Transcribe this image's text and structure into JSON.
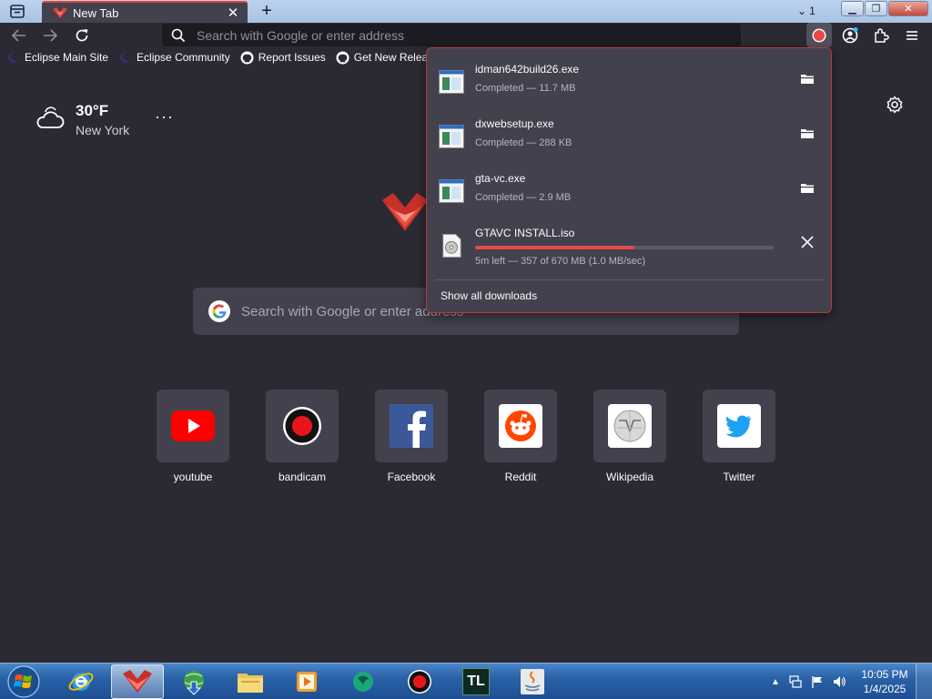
{
  "tabs": [
    {
      "title": "New Tab"
    }
  ],
  "tab_overflow_count": "1",
  "urlbar": {
    "placeholder": "Search with Google or enter address"
  },
  "bookmarks": [
    {
      "label": "Eclipse Main Site",
      "icon": "eclipse-icon"
    },
    {
      "label": "Eclipse Community",
      "icon": "eclipse-icon"
    },
    {
      "label": "Report Issues",
      "icon": "github-icon"
    },
    {
      "label": "Get New Releases",
      "icon": "github-icon"
    }
  ],
  "weather": {
    "temperature": "30°F",
    "city": "New York",
    "more": "···"
  },
  "search": {
    "placeholder": "Search with Google or enter address"
  },
  "shortcuts": [
    {
      "label": "youtube",
      "icon": "youtube-icon"
    },
    {
      "label": "bandicam",
      "icon": "bandicam-icon"
    },
    {
      "label": "Facebook",
      "icon": "facebook-icon"
    },
    {
      "label": "Reddit",
      "icon": "reddit-icon"
    },
    {
      "label": "Wikipedia",
      "icon": "wikipedia-icon"
    },
    {
      "label": "Twitter",
      "icon": "twitter-icon"
    }
  ],
  "downloads": {
    "items": [
      {
        "name": "idman642build26.exe",
        "status": "Completed — 11.7 MB"
      },
      {
        "name": "dxwebsetup.exe",
        "status": "Completed — 288 KB"
      },
      {
        "name": "gta-vc.exe",
        "status": "Completed — 2.9 MB"
      },
      {
        "name": "GTAVC INSTALL.iso",
        "status": "5m left — 357 of 670 MB (1.0 MB/sec)",
        "progress": 0.533
      }
    ],
    "show_all": "Show all downloads"
  },
  "taskbar": {
    "apps": [
      {
        "name": "internet-explorer"
      },
      {
        "name": "browser-active"
      },
      {
        "name": "internet-download-manager"
      },
      {
        "name": "file-explorer"
      },
      {
        "name": "media-player"
      },
      {
        "name": "green-app"
      },
      {
        "name": "bandicam"
      },
      {
        "name": "tl-launcher",
        "text": "TL"
      },
      {
        "name": "java"
      }
    ],
    "clock": {
      "time": "10:05 PM",
      "date": "1/4/2025"
    }
  },
  "colors": {
    "accent": "#e0413a",
    "background": "#2b2a33",
    "panel": "#42414d",
    "progress": "#e84a4a"
  }
}
